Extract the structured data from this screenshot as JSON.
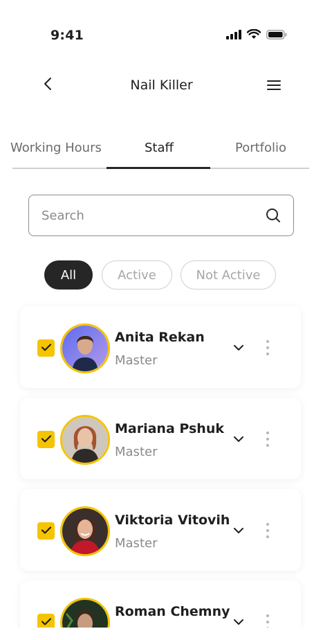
{
  "status_bar": {
    "time": "9:41",
    "icons": [
      "signal-icon",
      "wifi-icon",
      "battery-icon"
    ]
  },
  "header": {
    "title": "Nail Killer",
    "back_icon": "chevron-left-icon",
    "menu_icon": "hamburger-menu-icon"
  },
  "tabs": [
    {
      "label": "Working Hours",
      "selected": false
    },
    {
      "label": "Staff",
      "selected": true
    },
    {
      "label": "Portfolio",
      "selected": false
    }
  ],
  "search": {
    "placeholder": "Search",
    "icon": "search-icon"
  },
  "filters": [
    {
      "label": "All",
      "selected": true
    },
    {
      "label": "Active",
      "selected": false
    },
    {
      "label": "Not Active",
      "selected": false
    }
  ],
  "staff": [
    {
      "name": "Anita Rekan",
      "role": "Master",
      "checked": true
    },
    {
      "name": "Mariana Pshuk",
      "role": "Master",
      "checked": true
    },
    {
      "name": "Viktoria Vitovih",
      "role": "Master",
      "checked": true
    },
    {
      "name": "Roman Chemny",
      "role": "",
      "checked": true
    }
  ],
  "colors": {
    "accent": "#f5c400",
    "dark": "#262626",
    "muted": "#8a8a8a"
  }
}
